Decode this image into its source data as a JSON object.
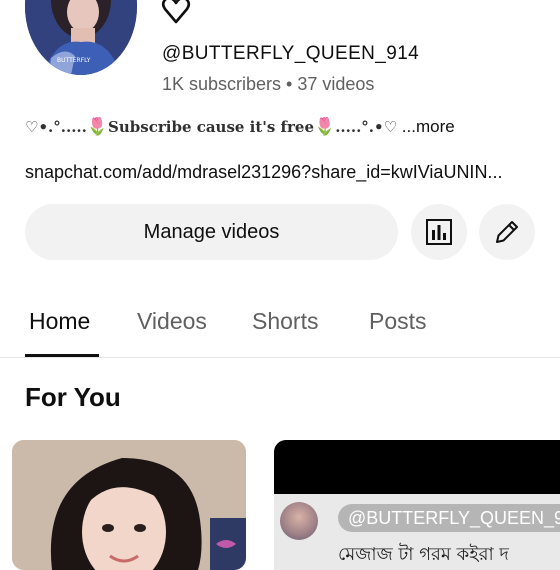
{
  "channel": {
    "handle": "@BUTTERFLY_QUEEN_914",
    "stats": "1K subscribers • 37 videos",
    "description": {
      "lead": "♡•.°.....",
      "tulip_1": "🌷",
      "middle": "Subscribe cause it's free",
      "tulip_2": "🌷",
      "trail": ".....°.•♡",
      "more": " ...more"
    },
    "link": "snapchat.com/add/mdrasel231296?share_id=kwIViaUNIN..."
  },
  "actions": {
    "manage_label": "Manage videos"
  },
  "tabs": [
    {
      "label": "Home",
      "active": true
    },
    {
      "label": "Videos",
      "active": false
    },
    {
      "label": "Shorts",
      "active": false
    },
    {
      "label": "Posts",
      "active": false
    }
  ],
  "section": {
    "title": "For You"
  },
  "videos": [
    {
      "thumbnail": "woman-portrait"
    },
    {
      "overlay_handle": "@BUTTERFLY_QUEEN_9",
      "overlay_text": "মেজাজ টা গরম কইরা দ"
    }
  ],
  "colors": {
    "text_primary": "#0f0f0f",
    "text_secondary": "#606060",
    "button_bg": "#f2f2f2",
    "tulip": "#c7203d"
  },
  "icons": {
    "heart": "heart-outline-icon",
    "analytics": "bar-chart-icon",
    "edit": "pencil-icon"
  }
}
